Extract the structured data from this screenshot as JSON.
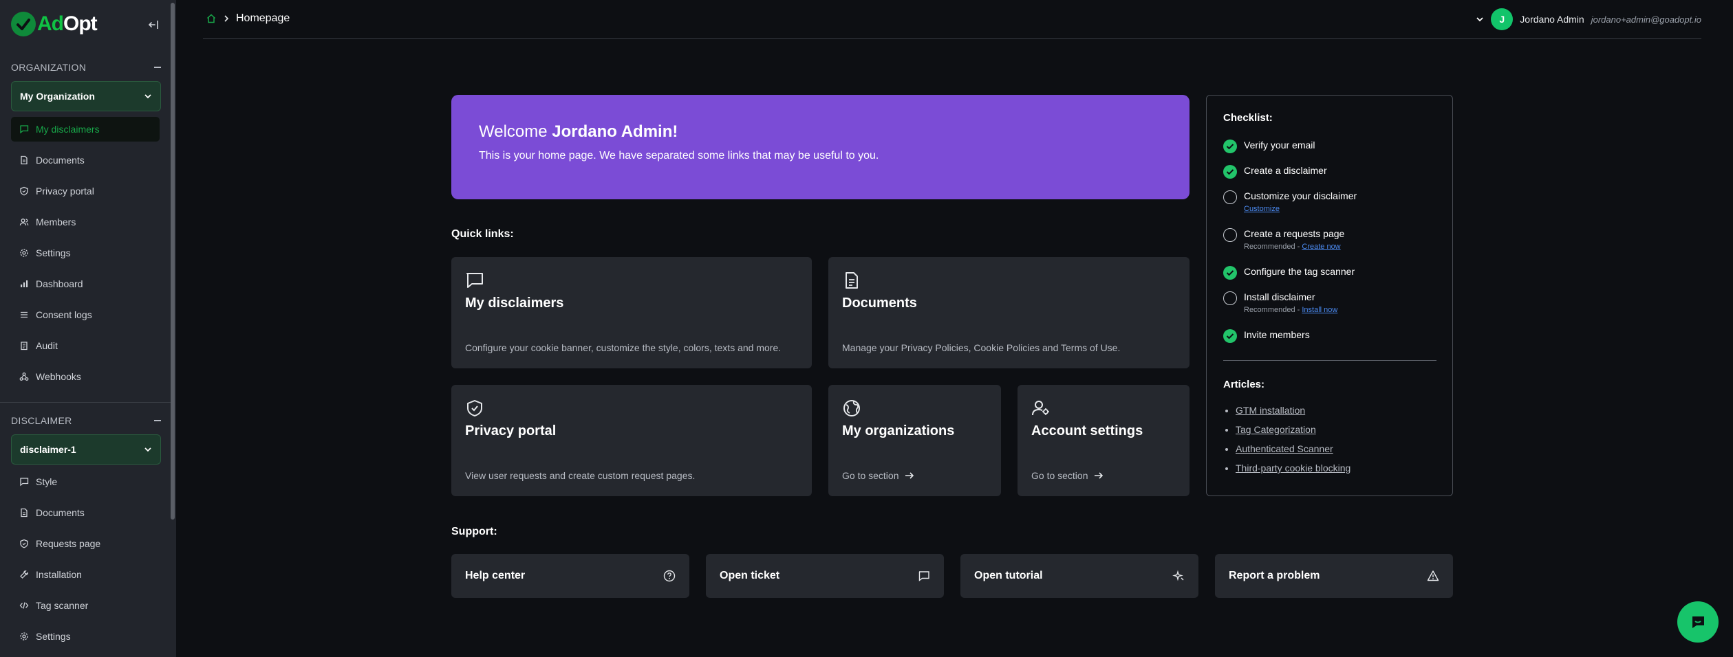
{
  "logo": {
    "ad": "Ad",
    "opt": "Opt"
  },
  "sidebar": {
    "org_section": "ORGANIZATION",
    "org_selected": "My Organization",
    "org_items": [
      {
        "label": "My disclaimers",
        "icon": "message-icon",
        "active": true
      },
      {
        "label": "Documents",
        "icon": "document-icon"
      },
      {
        "label": "Privacy portal",
        "icon": "shield-icon"
      },
      {
        "label": "Members",
        "icon": "users-icon"
      },
      {
        "label": "Settings",
        "icon": "gear-icon"
      },
      {
        "label": "Dashboard",
        "icon": "bar-chart-icon"
      },
      {
        "label": "Consent logs",
        "icon": "list-icon"
      },
      {
        "label": "Audit",
        "icon": "clipboard-icon"
      },
      {
        "label": "Webhooks",
        "icon": "webhook-icon"
      }
    ],
    "disc_section": "DISCLAIMER",
    "disc_selected": "disclaimer-1",
    "disc_items": [
      {
        "label": "Style",
        "icon": "message-icon"
      },
      {
        "label": "Documents",
        "icon": "document-icon"
      },
      {
        "label": "Requests page",
        "icon": "shield-icon"
      },
      {
        "label": "Installation",
        "icon": "wrench-icon"
      },
      {
        "label": "Tag scanner",
        "icon": "code-icon"
      },
      {
        "label": "Settings",
        "icon": "gear-icon"
      }
    ]
  },
  "header": {
    "breadcrumb": "Homepage",
    "user_initial": "J",
    "user_name": "Jordano Admin",
    "user_email": "jordano+admin@goadopt.io"
  },
  "welcome": {
    "greeting": "Welcome",
    "name": "Jordano Admin!",
    "text": "This is your home page. We have separated some links that may be useful to you."
  },
  "quick_links": {
    "label": "Quick links:",
    "cards": [
      {
        "title": "My disclaimers",
        "desc": "Configure your cookie banner, customize the style, colors, texts and more."
      },
      {
        "title": "Documents",
        "desc": "Manage your Privacy Policies, Cookie Policies and Terms of Use."
      },
      {
        "title": "Privacy portal",
        "desc": "View user requests and create custom request pages."
      },
      {
        "title": "My organizations",
        "desc": "Go to section"
      },
      {
        "title": "Account settings",
        "desc": "Go to section"
      }
    ]
  },
  "checklist": {
    "title": "Checklist:",
    "items": [
      {
        "label": "Verify your email",
        "done": true
      },
      {
        "label": "Create a disclaimer",
        "done": true
      },
      {
        "label": "Customize your disclaimer",
        "done": false,
        "link": "Customize"
      },
      {
        "label": "Create a requests page",
        "done": false,
        "prefix": "Recommended - ",
        "link": "Create now"
      },
      {
        "label": "Configure the tag scanner",
        "done": true
      },
      {
        "label": "Install disclaimer",
        "done": false,
        "prefix": "Recommended - ",
        "link": "Install now"
      },
      {
        "label": "Invite members",
        "done": true
      }
    ],
    "articles_title": "Articles:",
    "articles": [
      "GTM installation",
      "Tag Categorization",
      "Authenticated Scanner",
      "Third-party cookie blocking"
    ]
  },
  "support": {
    "label": "Support:",
    "items": [
      {
        "label": "Help center",
        "icon": "help-circle-icon"
      },
      {
        "label": "Open ticket",
        "icon": "message-icon"
      },
      {
        "label": "Open tutorial",
        "icon": "sparkles-icon"
      },
      {
        "label": "Report a problem",
        "icon": "warning-icon"
      }
    ]
  },
  "colors": {
    "accent": "#18a84a",
    "welcome_bg": "#7b4cd6",
    "check": "#22c46a"
  }
}
